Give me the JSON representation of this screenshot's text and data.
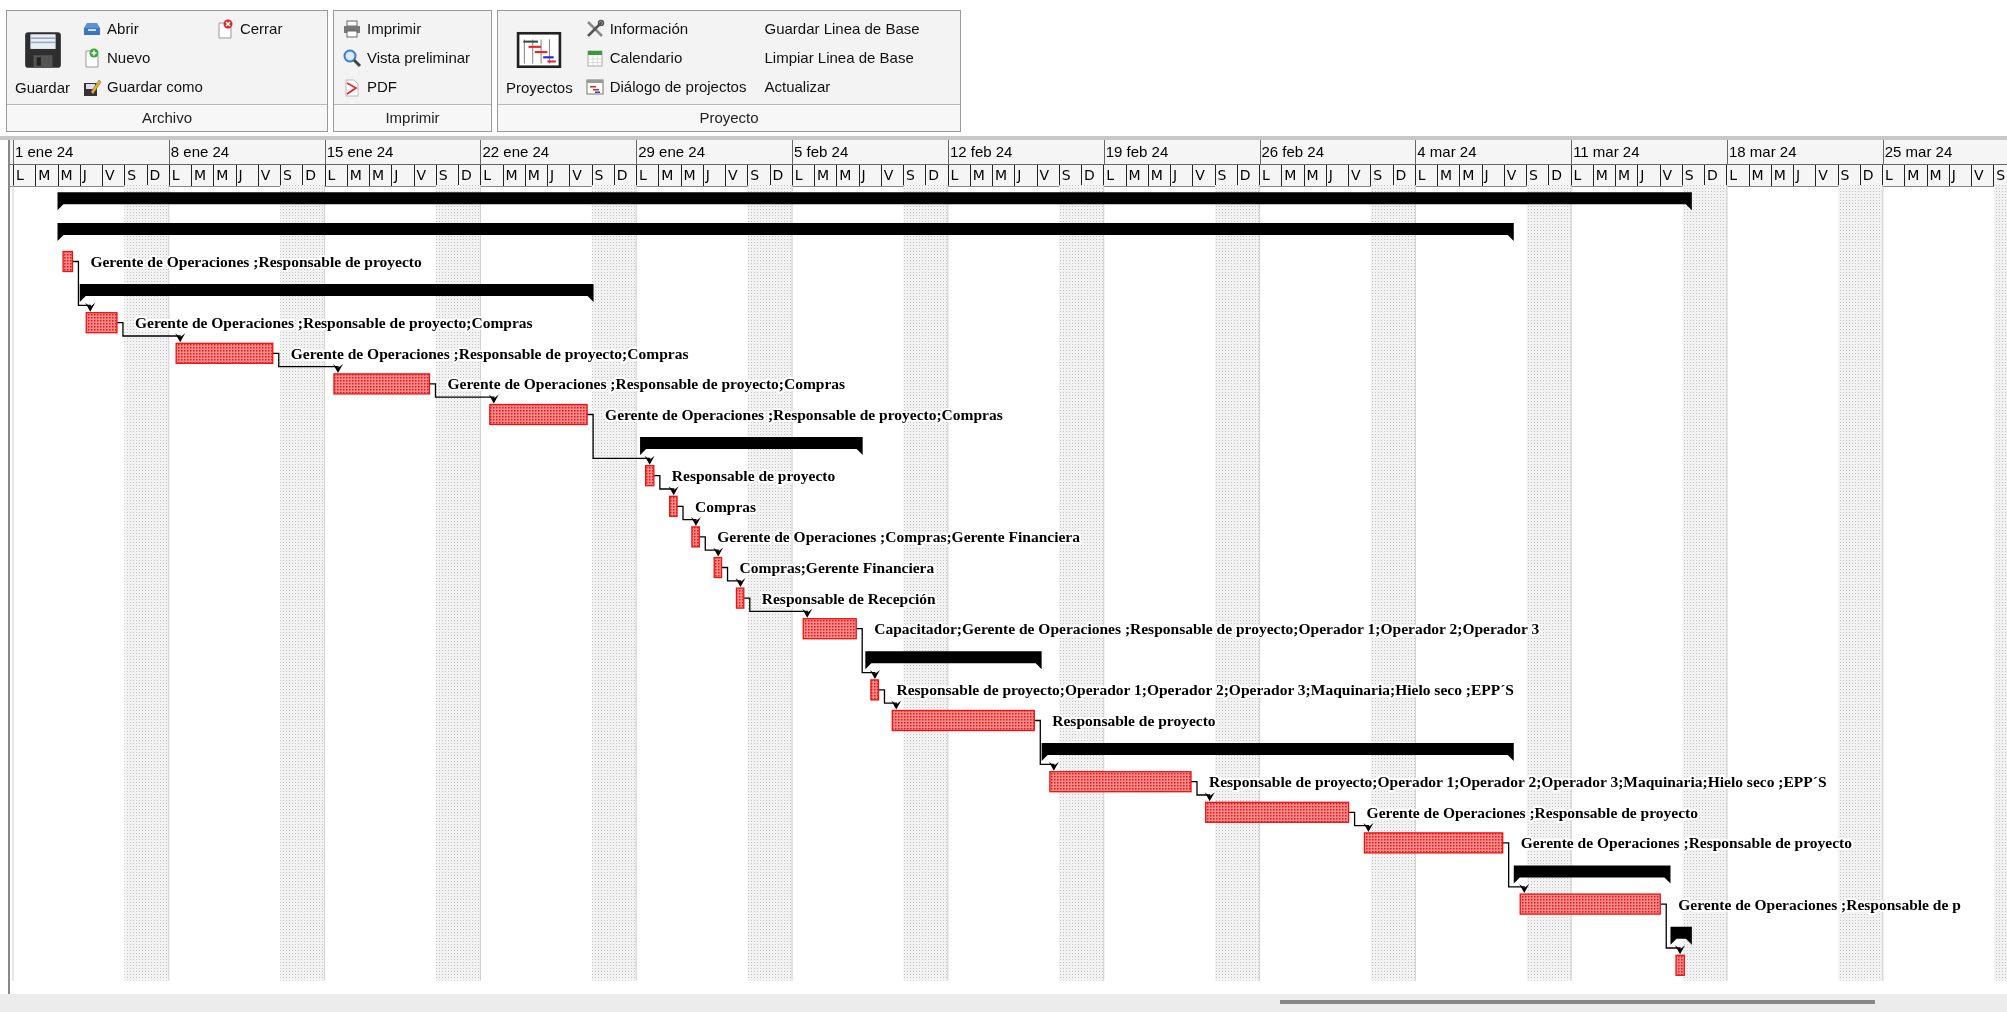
{
  "ribbon": {
    "groups": [
      {
        "caption": "Archivo",
        "columns": [
          {
            "kind": "large",
            "items": [
              {
                "label": "Guardar"
              }
            ]
          },
          {
            "kind": "small",
            "items": [
              {
                "label": "Abrir"
              },
              {
                "label": "Nuevo"
              },
              {
                "label": "Guardar como"
              }
            ]
          },
          {
            "kind": "small",
            "items": [
              {
                "label": "Cerrar"
              }
            ]
          }
        ]
      },
      {
        "caption": "Imprimir",
        "columns": [
          {
            "kind": "small",
            "items": [
              {
                "label": "Imprimir"
              },
              {
                "label": "Vista preliminar"
              },
              {
                "label": "PDF"
              }
            ]
          }
        ]
      },
      {
        "caption": "Proyecto",
        "columns": [
          {
            "kind": "large",
            "items": [
              {
                "label": "Proyectos"
              }
            ]
          },
          {
            "kind": "small",
            "items": [
              {
                "label": "Información"
              },
              {
                "label": "Calendario"
              },
              {
                "label": "Diálogo de projectos"
              }
            ]
          },
          {
            "kind": "text",
            "items": [
              {
                "label": "Guardar Linea de Base"
              },
              {
                "label": "Limpiar Linea de Base"
              },
              {
                "label": "Actualizar"
              }
            ]
          }
        ]
      }
    ]
  },
  "timeline": {
    "weeks": [
      {
        "label": "1 ene 24",
        "days": [
          "L",
          "M",
          "M",
          "J",
          "V",
          "S",
          "D"
        ]
      },
      {
        "label": "8 ene 24",
        "days": [
          "L",
          "M",
          "M",
          "J",
          "V",
          "S",
          "D"
        ]
      },
      {
        "label": "15 ene 24",
        "days": [
          "L",
          "M",
          "M",
          "J",
          "V",
          "S",
          "D"
        ]
      },
      {
        "label": "22 ene 24",
        "days": [
          "L",
          "M",
          "M",
          "J",
          "V",
          "S",
          "D"
        ]
      },
      {
        "label": "29 ene 24",
        "days": [
          "L",
          "M",
          "M",
          "J",
          "V",
          "S",
          "D"
        ]
      },
      {
        "label": "5 feb 24",
        "days": [
          "L",
          "M",
          "M",
          "J",
          "V",
          "S",
          "D"
        ]
      },
      {
        "label": "12 feb 24",
        "days": [
          "L",
          "M",
          "M",
          "J",
          "V",
          "S",
          "D"
        ]
      },
      {
        "label": "19 feb 24",
        "days": [
          "L",
          "M",
          "M",
          "J",
          "V",
          "S",
          "D"
        ]
      },
      {
        "label": "26 feb 24",
        "days": [
          "L",
          "M",
          "M",
          "J",
          "V",
          "S",
          "D"
        ]
      },
      {
        "label": "4 mar 24",
        "days": [
          "L",
          "M",
          "M",
          "J",
          "V",
          "S",
          "D"
        ]
      },
      {
        "label": "11 mar 24",
        "days": [
          "L",
          "M",
          "M",
          "J",
          "V",
          "S",
          "D"
        ]
      },
      {
        "label": "18 mar 24",
        "days": [
          "L",
          "M",
          "M",
          "J",
          "V",
          "S",
          "D"
        ]
      },
      {
        "label": "25 mar 24",
        "days": [
          "L",
          "M",
          "M",
          "J",
          "V",
          "S"
        ]
      }
    ]
  },
  "rows": [
    {
      "kind": "summary"
    },
    {
      "kind": "summary"
    },
    {
      "kind": "task",
      "resources": "Gerente de Operaciones ;Responsable de proyecto",
      "arrow_in": false
    },
    {
      "kind": "summary"
    },
    {
      "kind": "task",
      "resources": "Gerente de Operaciones ;Responsable de proyecto;Compras",
      "arrow_in": true
    },
    {
      "kind": "task",
      "resources": "Gerente de Operaciones ;Responsable de proyecto;Compras",
      "arrow_in": true
    },
    {
      "kind": "task",
      "resources": "Gerente de Operaciones ;Responsable de proyecto;Compras",
      "arrow_in": true
    },
    {
      "kind": "task",
      "resources": "Gerente de Operaciones ;Responsable de proyecto;Compras",
      "arrow_in": true
    },
    {
      "kind": "summary"
    },
    {
      "kind": "task",
      "resources": "Responsable de proyecto",
      "arrow_in": true
    },
    {
      "kind": "task",
      "resources": "Compras",
      "arrow_in": true
    },
    {
      "kind": "task",
      "resources": "Gerente de Operaciones ;Compras;Gerente Financiera",
      "arrow_in": true
    },
    {
      "kind": "task",
      "resources": "Compras;Gerente Financiera",
      "arrow_in": true
    },
    {
      "kind": "task",
      "resources": "Responsable de Recepción",
      "arrow_in": true
    },
    {
      "kind": "task",
      "resources": "Capacitador;Gerente de Operaciones ;Responsable de proyecto;Operador 1;Operador 2;Operador 3",
      "arrow_in": true
    },
    {
      "kind": "summary"
    },
    {
      "kind": "task",
      "resources": "Responsable de proyecto;Operador 1;Operador 2;Operador 3;Maquinaria;Hielo seco ;EPP´S",
      "arrow_in": true
    },
    {
      "kind": "task",
      "resources": "Responsable de proyecto",
      "arrow_in": true
    },
    {
      "kind": "summary"
    },
    {
      "kind": "task",
      "resources": "Responsable de proyecto;Operador 1;Operador 2;Operador 3;Maquinaria;Hielo seco ;EPP´S",
      "arrow_in": true
    },
    {
      "kind": "task",
      "resources": "Gerente de Operaciones ;Responsable de proyecto",
      "arrow_in": true
    },
    {
      "kind": "task",
      "resources": "Gerente de Operaciones ;Responsable de proyecto",
      "arrow_in": true
    },
    {
      "kind": "summary"
    },
    {
      "kind": "task",
      "resources": "Gerente de Operaciones ;Responsable de p",
      "arrow_in": true
    },
    {
      "kind": "summary"
    },
    {
      "kind": "task",
      "arrow_in": true
    }
  ]
}
